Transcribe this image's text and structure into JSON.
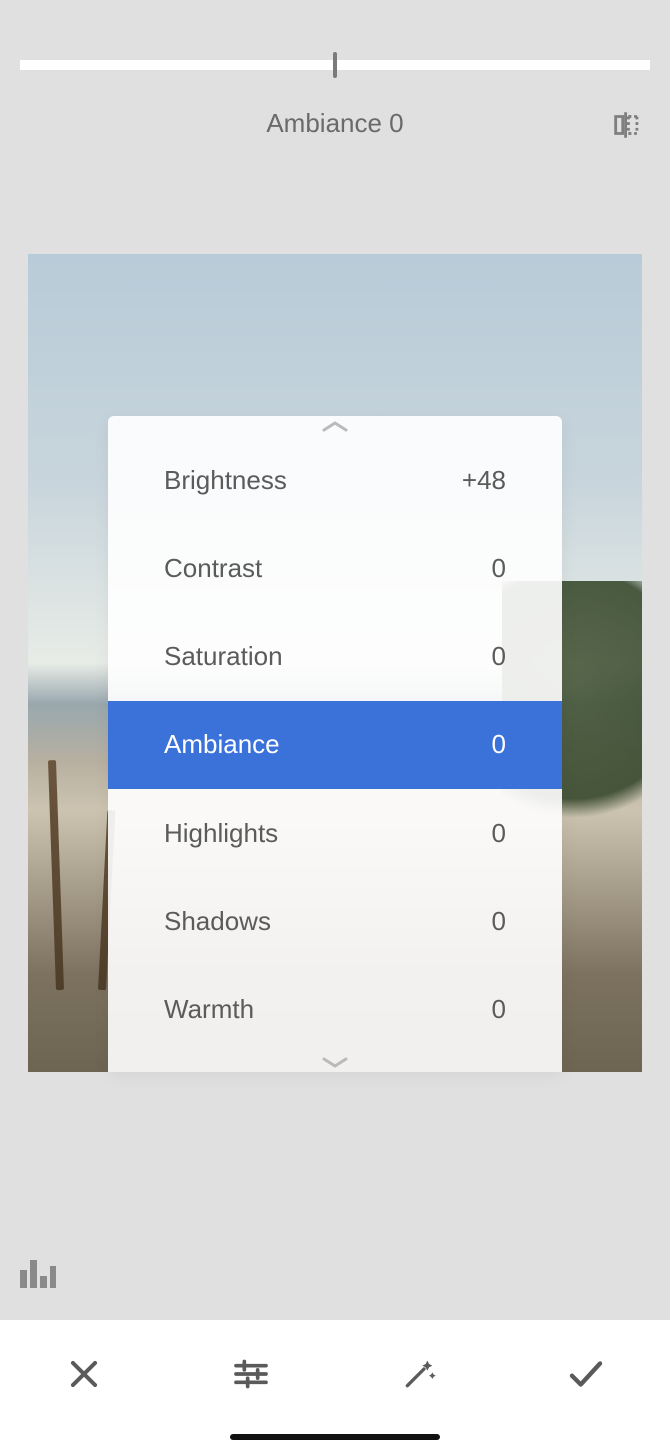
{
  "slider": {
    "label": "Ambiance 0",
    "icons": {
      "compare": "compare-icon"
    }
  },
  "adjustments": {
    "selectedIndex": 3,
    "items": [
      {
        "label": "Brightness",
        "value": "+48"
      },
      {
        "label": "Contrast",
        "value": "0"
      },
      {
        "label": "Saturation",
        "value": "0"
      },
      {
        "label": "Ambiance",
        "value": "0"
      },
      {
        "label": "Highlights",
        "value": "0"
      },
      {
        "label": "Shadows",
        "value": "0"
      },
      {
        "label": "Warmth",
        "value": "0"
      }
    ]
  },
  "toolbar": {
    "icons": {
      "close": "close-icon",
      "tune": "tune-icon",
      "wand": "magic-wand-icon",
      "apply": "checkmark-icon"
    }
  },
  "overlay": {
    "icons": {
      "histogram": "histogram-icon",
      "handle_up": "chevron-up-icon",
      "handle_down": "chevron-down-icon"
    }
  },
  "colors": {
    "selection": "#3b72d9"
  }
}
